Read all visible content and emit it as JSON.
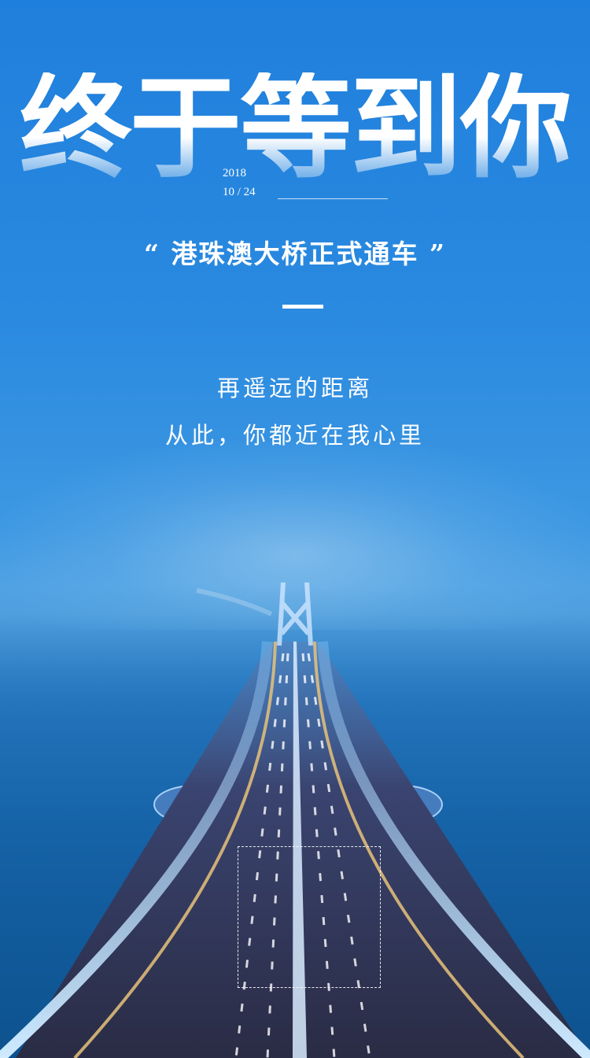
{
  "title": "终于等到你",
  "date": {
    "year": "2018",
    "day": "10 / 24"
  },
  "subtitle": "“ 港珠澳大桥正式通车 ”",
  "poem": {
    "line1": "再遥远的距离",
    "line2": "从此，你都近在我心里"
  },
  "colors": {
    "sky": "#2a8ae0",
    "sea": "#12609f",
    "road": "#2c2f4a",
    "text": "#ffffff"
  }
}
